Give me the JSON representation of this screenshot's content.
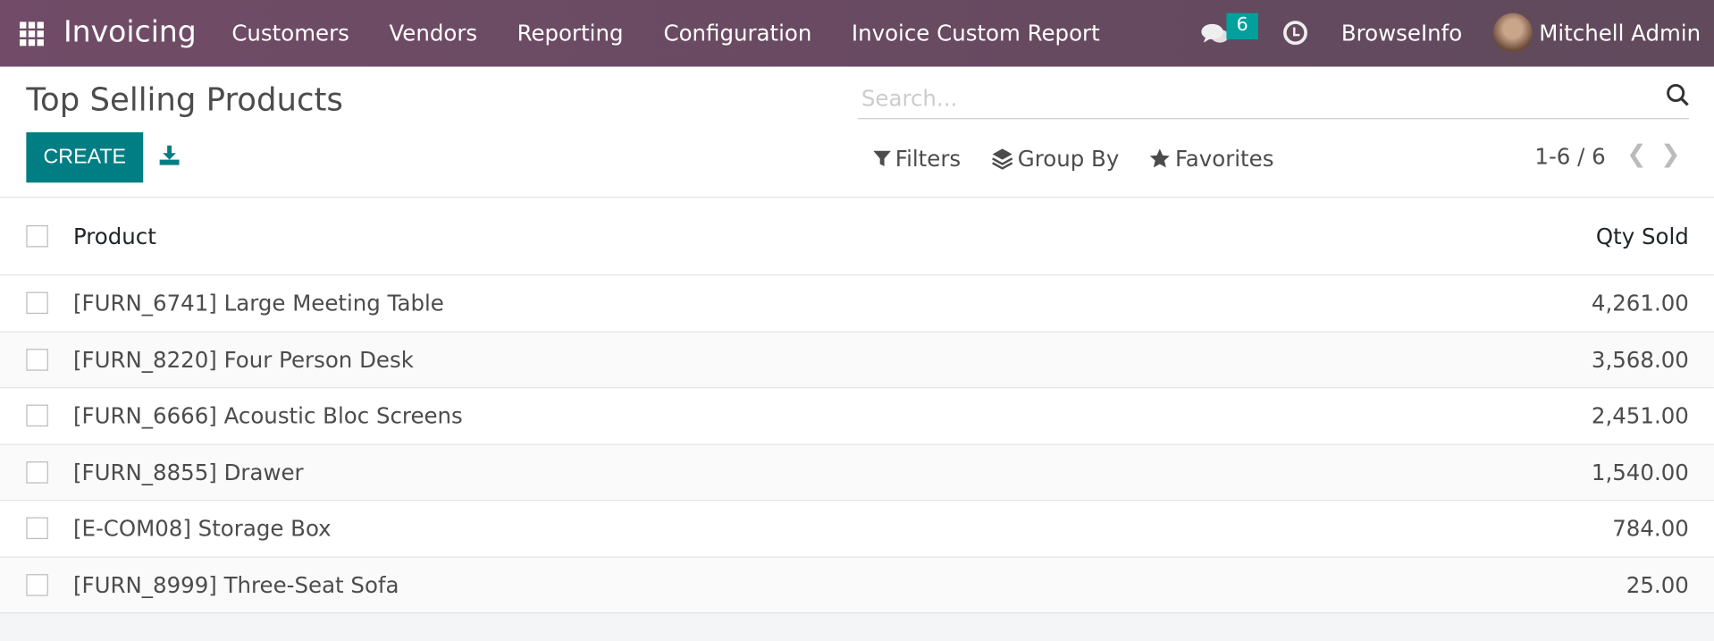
{
  "navbar": {
    "app_name": "Invoicing",
    "menus": [
      "Customers",
      "Vendors",
      "Reporting",
      "Configuration",
      "Invoice Custom Report"
    ],
    "message_count": "6",
    "company": "BrowseInfo",
    "user": "Mitchell Admin"
  },
  "control": {
    "title": "Top Selling Products",
    "create_label": "CREATE",
    "search_placeholder": "Search...",
    "filters_label": "Filters",
    "group_by_label": "Group By",
    "favorites_label": "Favorites",
    "pager": "1-6 / 6"
  },
  "table": {
    "headers": {
      "product": "Product",
      "qty": "Qty Sold"
    },
    "rows": [
      {
        "product": "[FURN_6741] Large Meeting Table",
        "qty": "4,261.00"
      },
      {
        "product": "[FURN_8220] Four Person Desk",
        "qty": "3,568.00"
      },
      {
        "product": "[FURN_6666] Acoustic Bloc Screens",
        "qty": "2,451.00"
      },
      {
        "product": "[FURN_8855] Drawer",
        "qty": "1,540.00"
      },
      {
        "product": "[E-COM08] Storage Box",
        "qty": "784.00"
      },
      {
        "product": "[FURN_8999] Three-Seat Sofa",
        "qty": "25.00"
      }
    ]
  },
  "colors": {
    "navbar": "#714b67",
    "primary": "#017e84",
    "badge": "#00a09d"
  }
}
